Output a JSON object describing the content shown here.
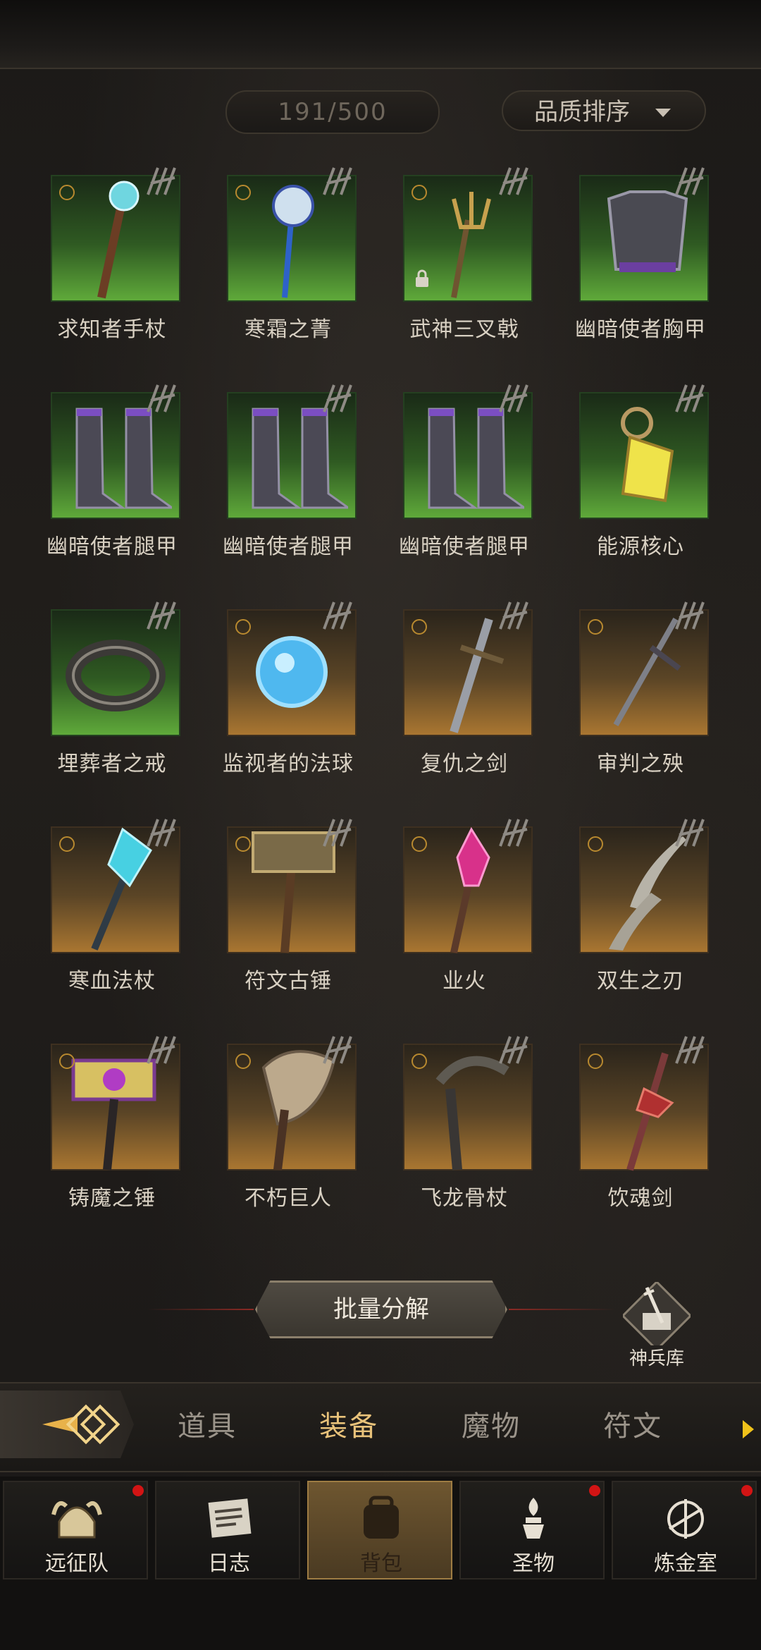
{
  "header": {
    "count_label": "191/500",
    "sort_label": "品质排序"
  },
  "items": [
    {
      "name": "求知者手杖",
      "quality": "green",
      "selectable": true,
      "locked": false,
      "art": "staff-orb"
    },
    {
      "name": "寒霜之菁",
      "quality": "green",
      "selectable": true,
      "locked": false,
      "art": "frost-wand"
    },
    {
      "name": "武神三叉戟",
      "quality": "green",
      "selectable": true,
      "locked": true,
      "art": "trident"
    },
    {
      "name": "幽暗使者胸甲",
      "quality": "green",
      "selectable": false,
      "locked": false,
      "art": "chest-armor"
    },
    {
      "name": "幽暗使者腿甲",
      "quality": "green",
      "selectable": false,
      "locked": false,
      "art": "boots"
    },
    {
      "name": "幽暗使者腿甲",
      "quality": "green",
      "selectable": false,
      "locked": false,
      "art": "boots"
    },
    {
      "name": "幽暗使者腿甲",
      "quality": "green",
      "selectable": false,
      "locked": false,
      "art": "boots"
    },
    {
      "name": "能源核心",
      "quality": "green",
      "selectable": false,
      "locked": false,
      "art": "amulet"
    },
    {
      "name": "埋葬者之戒",
      "quality": "green",
      "selectable": false,
      "locked": false,
      "art": "ring"
    },
    {
      "name": "监视者的法球",
      "quality": "gold",
      "selectable": true,
      "locked": false,
      "art": "orb"
    },
    {
      "name": "复仇之剑",
      "quality": "gold",
      "selectable": true,
      "locked": false,
      "art": "sword"
    },
    {
      "name": "审判之殃",
      "quality": "gold",
      "selectable": true,
      "locked": false,
      "art": "dagger"
    },
    {
      "name": "寒血法杖",
      "quality": "gold",
      "selectable": true,
      "locked": false,
      "art": "ice-staff"
    },
    {
      "name": "符文古锤",
      "quality": "gold",
      "selectable": true,
      "locked": false,
      "art": "hammer"
    },
    {
      "name": "业火",
      "quality": "gold",
      "selectable": true,
      "locked": false,
      "art": "fire-wand"
    },
    {
      "name": "双生之刃",
      "quality": "gold",
      "selectable": true,
      "locked": false,
      "art": "twin-blades"
    },
    {
      "name": "铸魔之锤",
      "quality": "gold",
      "selectable": true,
      "locked": false,
      "art": "demon-hammer"
    },
    {
      "name": "不朽巨人",
      "quality": "gold",
      "selectable": true,
      "locked": false,
      "art": "skull-axe"
    },
    {
      "name": "飞龙骨杖",
      "quality": "gold",
      "selectable": true,
      "locked": false,
      "art": "bone-staff"
    },
    {
      "name": "饮魂剑",
      "quality": "gold",
      "selectable": true,
      "locked": false,
      "art": "soul-sword"
    }
  ],
  "actions": {
    "batch_label": "批量分解",
    "arsenal_label": "神兵库"
  },
  "tabs": [
    {
      "label": "道具"
    },
    {
      "label": "装备",
      "active": true
    },
    {
      "label": "魔物"
    },
    {
      "label": "符文"
    }
  ],
  "nav": [
    {
      "label": "远征队",
      "icon": "helmet-icon",
      "badge": true
    },
    {
      "label": "日志",
      "icon": "scroll-icon",
      "badge": false
    },
    {
      "label": "背包",
      "icon": "backpack-icon",
      "badge": false,
      "active": true
    },
    {
      "label": "圣物",
      "icon": "relic-icon",
      "badge": true
    },
    {
      "label": "炼金室",
      "icon": "alchemy-icon",
      "badge": true
    }
  ],
  "colors": {
    "green_quality": "#5fa93a",
    "gold_quality": "#a97631",
    "active_tab": "#e8c27a",
    "badge": "#d21414"
  }
}
